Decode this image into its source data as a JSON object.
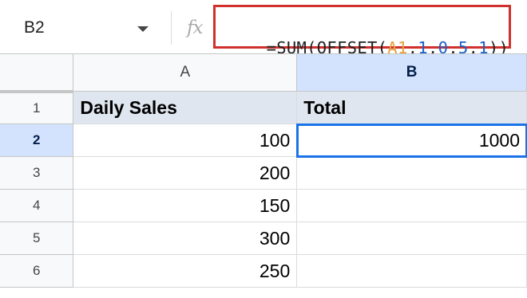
{
  "name_box": {
    "value": "B2"
  },
  "formula": {
    "fx_label": "fx",
    "tokens": [
      {
        "text": "=SUM(OFFSET(",
        "kind": "plain"
      },
      {
        "text": "A1",
        "kind": "ref"
      },
      {
        "text": ",",
        "kind": "plain"
      },
      {
        "text": "1",
        "kind": "num"
      },
      {
        "text": ",",
        "kind": "plain"
      },
      {
        "text": "0",
        "kind": "num"
      },
      {
        "text": ",",
        "kind": "plain"
      },
      {
        "text": "5",
        "kind": "num"
      },
      {
        "text": ",",
        "kind": "plain"
      },
      {
        "text": "1",
        "kind": "num"
      },
      {
        "text": "))",
        "kind": "plain"
      }
    ]
  },
  "columns": [
    "A",
    "B"
  ],
  "rows": [
    {
      "num": "1",
      "a": "Daily Sales",
      "b": "Total"
    },
    {
      "num": "2",
      "a": "100",
      "b": "1000"
    },
    {
      "num": "3",
      "a": "200",
      "b": ""
    },
    {
      "num": "4",
      "a": "150",
      "b": ""
    },
    {
      "num": "5",
      "a": "300",
      "b": ""
    },
    {
      "num": "6",
      "a": "250",
      "b": ""
    }
  ],
  "colors": {
    "highlight_border": "#d0312d",
    "selection": "#1a73e8",
    "header_fill": "#dfe6ef",
    "ref_token": "#e8a03c",
    "num_token": "#1a5fc9"
  }
}
